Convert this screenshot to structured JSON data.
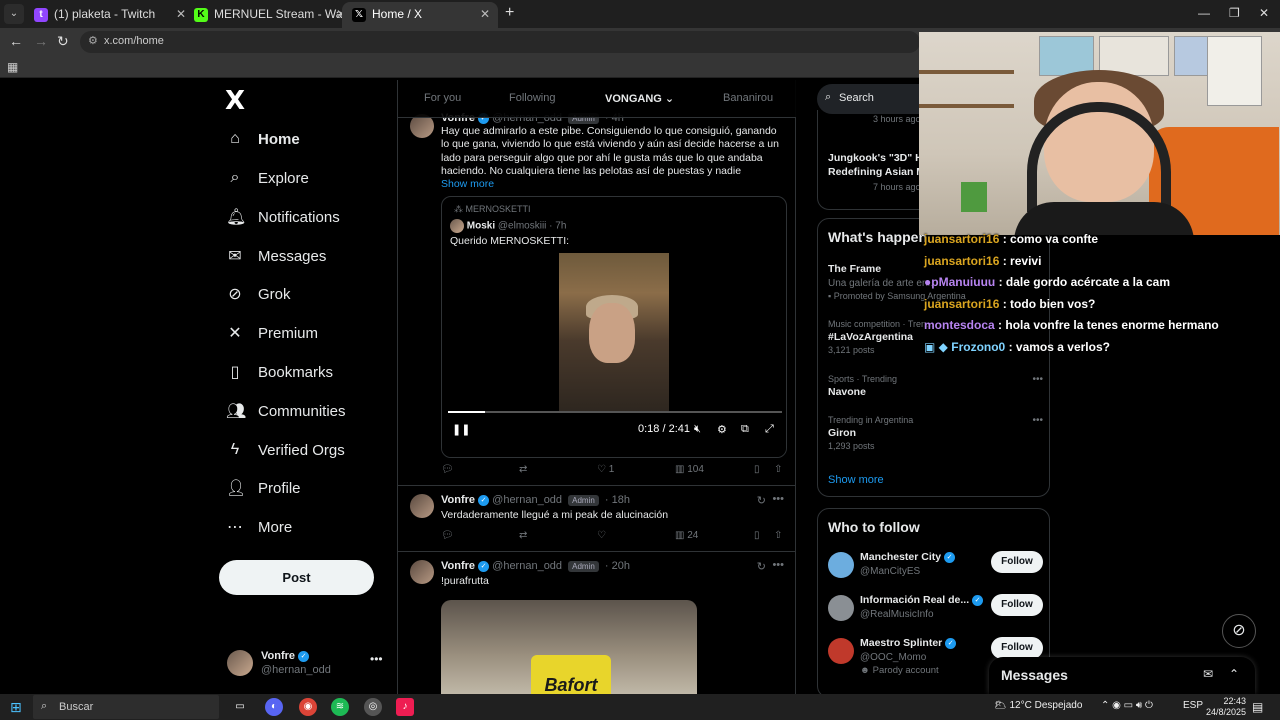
{
  "browser": {
    "tabs": [
      {
        "title": "(1) plaketa - Twitch",
        "favicon": "twitch-icon",
        "color": "#9146ff",
        "active": false
      },
      {
        "title": "MERNUEL Stream - Watch Live",
        "favicon": "kick-icon",
        "color": "#53fc18",
        "active": false
      },
      {
        "title": "Home / X",
        "favicon": "x-icon",
        "color": "#000000",
        "active": true
      }
    ],
    "url": "x.com/home"
  },
  "sidebar": {
    "logo": "X",
    "items": [
      {
        "label": "Home",
        "icon": "home-icon",
        "bold": true
      },
      {
        "label": "Explore",
        "icon": "search-icon"
      },
      {
        "label": "Notifications",
        "icon": "bell-icon"
      },
      {
        "label": "Messages",
        "icon": "envelope-icon"
      },
      {
        "label": "Grok",
        "icon": "grok-icon"
      },
      {
        "label": "Premium",
        "icon": "x-premium-icon"
      },
      {
        "label": "Bookmarks",
        "icon": "bookmark-icon"
      },
      {
        "label": "Communities",
        "icon": "communities-icon"
      },
      {
        "label": "Verified Orgs",
        "icon": "lightning-icon"
      },
      {
        "label": "Profile",
        "icon": "person-icon"
      },
      {
        "label": "More",
        "icon": "more-circle-icon"
      }
    ],
    "post_label": "Post",
    "account": {
      "name": "Vonfre",
      "handle": "@hernan_odd"
    }
  },
  "feed": {
    "tabs": [
      "For you",
      "Following",
      "VONGANG",
      "Bananirou"
    ],
    "active_tab": "VONGANG",
    "tweets": [
      {
        "name": "Vonfre",
        "handle": "@hernan_odd",
        "badge": "Admin",
        "time": "4h",
        "text": "Hay que admirarlo a este pibe. Consiguiendo lo que consiguió, ganando lo que gana, viviendo lo que está viviendo y aún así decide hacerse a un lado para perseguir algo que por ahí le gusta más que lo que andaba haciendo. No cualquiera tiene las pelotas así de puestas y nadie",
        "show_more": "Show more",
        "quote": {
          "label": "MERNOSKETTI",
          "name": "Moski",
          "handle": "@elmoskiii",
          "time": "7h",
          "text": "Querido MERNOSKETTI:",
          "video_time": "0:18 / 2:41",
          "progress": 0.11
        },
        "stats": {
          "reply": "",
          "repost": "",
          "like": "1",
          "views": "104"
        }
      },
      {
        "name": "Vonfre",
        "handle": "@hernan_odd",
        "badge": "Admin",
        "time": "18h",
        "text": "Verdaderamente llegué a mi peak de alucinación",
        "stats": {
          "reply": "",
          "repost": "",
          "like": "",
          "views": "24"
        }
      },
      {
        "name": "Vonfre",
        "handle": "@hernan_odd",
        "badge": "Admin",
        "time": "20h",
        "text": "!purafrutta",
        "image_text": "Bafort"
      }
    ]
  },
  "right": {
    "search_placeholder": "Search",
    "top_snippets": [
      {
        "meta": "3 hours ago"
      },
      {
        "title": "Jungkook's \"3D\" Hi...",
        "subtitle": "Redefining Asian M...",
        "meta": "7 hours ago"
      }
    ],
    "happening": {
      "title": "What's happen...",
      "trends": [
        {
          "meta": "",
          "title": "The Frame",
          "sub": "Una galería de arte en...",
          "count": "Promoted by Samsung Argentina"
        },
        {
          "meta": "Music competition · Tren...",
          "title": "#LaVozArgentina",
          "count": "3,121 posts"
        },
        {
          "meta": "Sports · Trending",
          "title": "Navone",
          "count": ""
        },
        {
          "meta": "Trending in Argentina",
          "title": "Giron",
          "count": "1,293 posts"
        }
      ],
      "show_more": "Show more"
    },
    "who_to_follow": {
      "title": "Who to follow",
      "accounts": [
        {
          "name": "Manchester City",
          "handle": "@ManCityES",
          "follow": "Follow",
          "color": "#6caddf"
        },
        {
          "name": "Información Real de...",
          "handle": "@RealMusicInfo",
          "follow": "Follow",
          "color": "#8a8f94"
        },
        {
          "name": "Maestro Splinter",
          "handle": "@OOC_Momo",
          "parody": "Parody account",
          "follow": "Follow",
          "color": "#c0392b"
        }
      ]
    },
    "messages_label": "Messages"
  },
  "chat": [
    {
      "user": "juansartori16",
      "msg": "como va confte",
      "color": "#daa520"
    },
    {
      "user": "juansartori16",
      "msg": "revivi",
      "color": "#daa520"
    },
    {
      "user": "pManuiuuu",
      "msg": "dale gordo acércate a la cam",
      "color": "#b784f0"
    },
    {
      "user": "juansartori16",
      "msg": "todo bien vos?",
      "color": "#daa520"
    },
    {
      "user": "montesdoca",
      "msg": "hola vonfre la tenes enorme hermano",
      "color": "#b784f0"
    },
    {
      "user": "Frozono0",
      "msg": "vamos a verlos?",
      "color": "#7fd3ff"
    }
  ],
  "taskbar": {
    "search_placeholder": "Buscar",
    "weather": "12°C",
    "weather_desc": "Despejado",
    "lang": "ESP",
    "time": "22:43",
    "date": "24/8/2025"
  }
}
